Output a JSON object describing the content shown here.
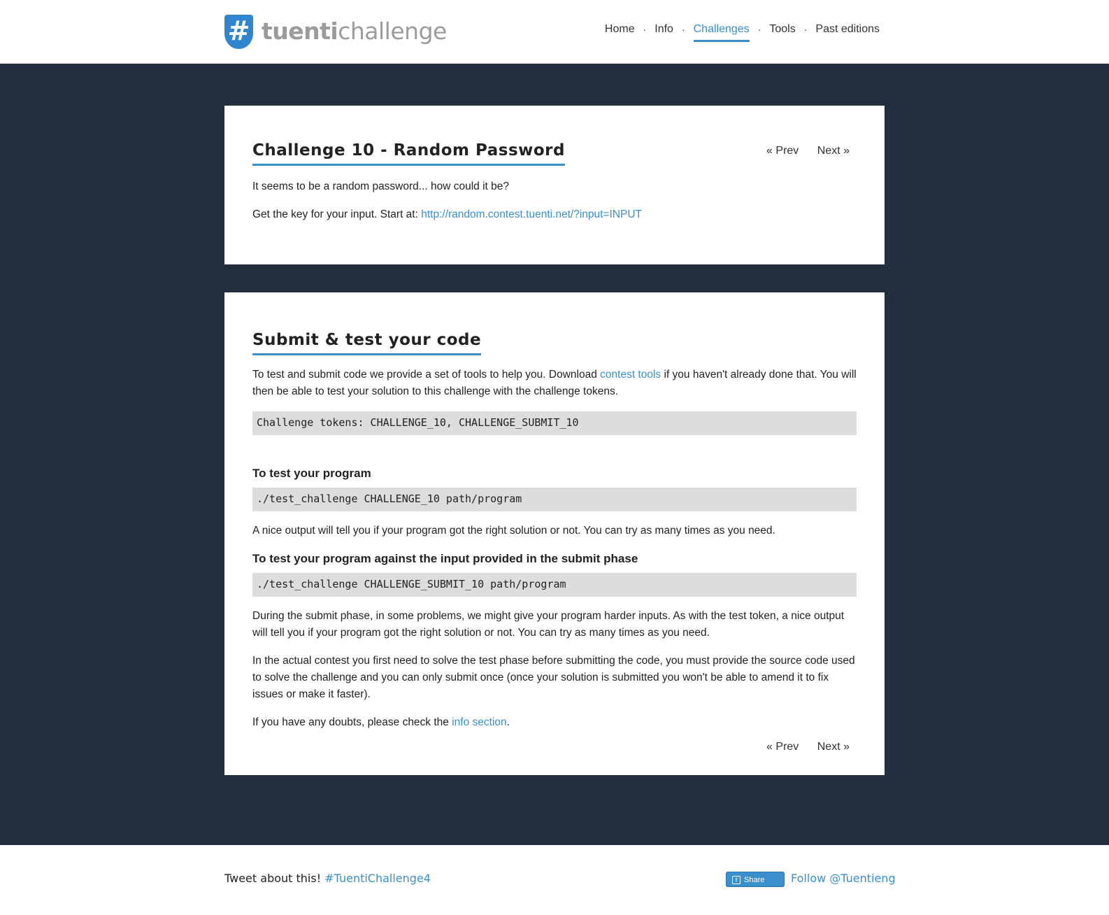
{
  "header": {
    "logo_mark": "#",
    "logo_bold": "tuenti",
    "logo_light": "challenge",
    "nav": [
      {
        "label": "Home",
        "active": false
      },
      {
        "label": "Info",
        "active": false
      },
      {
        "label": "Challenges",
        "active": true
      },
      {
        "label": "Tools",
        "active": false
      },
      {
        "label": "Past editions",
        "active": false
      }
    ],
    "separator": "·"
  },
  "challenge": {
    "title": "Challenge 10 - Random Password",
    "prev": "« Prev",
    "next": "Next »",
    "description": "It seems to be a random password... how could it be?",
    "start_text": "Get the key for your input. Start at: ",
    "start_link": "http://random.contest.tuenti.net/?input=INPUT"
  },
  "submit": {
    "title": "Submit & test your code",
    "intro_1": "To test and submit code we provide a set of tools to help you. Download ",
    "intro_link": "contest tools",
    "intro_2": " if you haven't already done that. You will then be able to test your solution to this challenge with the challenge tokens.",
    "tokens_code": "Challenge tokens: CHALLENGE_10, CHALLENGE_SUBMIT_10",
    "test_heading": "To test your program",
    "test_code": "./test_challenge CHALLENGE_10 path/program",
    "test_note": "A nice output will tell you if your program got the right solution or not. You can try as many times as you need.",
    "submit_heading": "To test your program against the input provided in the submit phase",
    "submit_code": "./test_challenge CHALLENGE_SUBMIT_10 path/program",
    "submit_note": "During the submit phase, in some problems, we might give your program harder inputs. As with the test token, a nice output will tell you if your program got the right solution or not. You can try as many times as you need.",
    "contest_note": "In the actual contest you first need to solve the test phase before submitting the code, you must provide the source code used to solve the challenge and you can only submit once (once your solution is submitted you won't be able to amend it to fix issues or make it faster).",
    "doubts_1": "If you have any doubts, please check the ",
    "doubts_link": "info section",
    "doubts_2": ".",
    "prev": "« Prev",
    "next": "Next »"
  },
  "footer": {
    "tweet_text": "Tweet about this! ",
    "hashtag": "#TuentiChallenge4",
    "share_label": "Share",
    "follow": "Follow @Tuentieng"
  }
}
